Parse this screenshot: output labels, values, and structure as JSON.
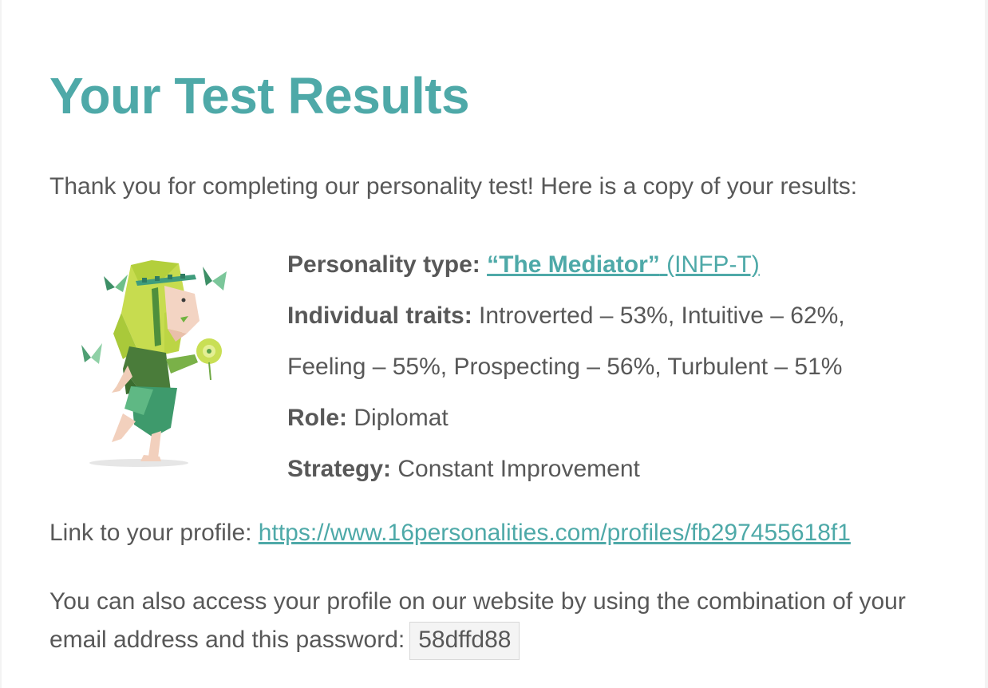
{
  "header": {
    "title": "Your Test Results"
  },
  "intro": {
    "text": "Thank you for completing our personality test! Here is a copy of your results:"
  },
  "results": {
    "personality_type_label": "Personality type:",
    "personality_type_name": "“The Mediator”",
    "personality_type_code": " (INFP-T)",
    "traits_label": "Individual traits:",
    "traits_line1": " Introverted – 53%, Intuitive – 62%,",
    "traits_line2": "Feeling – 55%, Prospecting – 56%, Turbulent – 51%",
    "role_label": "Role:",
    "role_value": " Diplomat",
    "strategy_label": "Strategy:",
    "strategy_value": " Constant Improvement"
  },
  "profile": {
    "label": "Link to your profile: ",
    "url": "https://www.16personalities.com/profiles/fb297455618f1"
  },
  "access": {
    "text": "You can also access your profile on our website by using the combination of your email address and this password:",
    "password": "58dffd88"
  },
  "colors": {
    "accent": "#4ea9a8",
    "text": "#585858"
  }
}
